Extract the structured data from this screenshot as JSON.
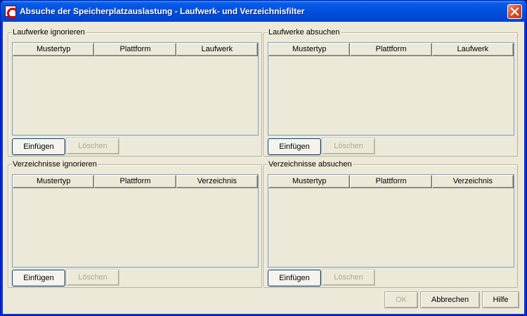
{
  "window": {
    "title": "Absuche der Speicherplatzauslastung - Laufwerk- und Verzeichnisfilter",
    "icon": "app-logo-icon",
    "close_icon": "close-icon"
  },
  "groups": {
    "drives_ignore": {
      "legend": "Laufwerke ignorieren",
      "columns": [
        "Mustertyp",
        "Plattform",
        "Laufwerk"
      ],
      "rows": [],
      "insert_label": "Einfügen",
      "delete_label": "Löschen"
    },
    "drives_scan": {
      "legend": "Laufwerke absuchen",
      "columns": [
        "Mustertyp",
        "Plattform",
        "Laufwerk"
      ],
      "rows": [],
      "insert_label": "Einfügen",
      "delete_label": "Löschen"
    },
    "dirs_ignore": {
      "legend": "Verzeichnisse ignorieren",
      "columns": [
        "Mustertyp",
        "Plattform",
        "Verzeichnis"
      ],
      "rows": [],
      "insert_label": "Einfügen",
      "delete_label": "Löschen"
    },
    "dirs_scan": {
      "legend": "Verzeichnisse absuchen",
      "columns": [
        "Mustertyp",
        "Plattform",
        "Verzeichnis"
      ],
      "rows": [],
      "insert_label": "Einfügen",
      "delete_label": "Löschen"
    }
  },
  "footer": {
    "ok_label": "OK",
    "cancel_label": "Abbrechen",
    "help_label": "Hilfe"
  }
}
